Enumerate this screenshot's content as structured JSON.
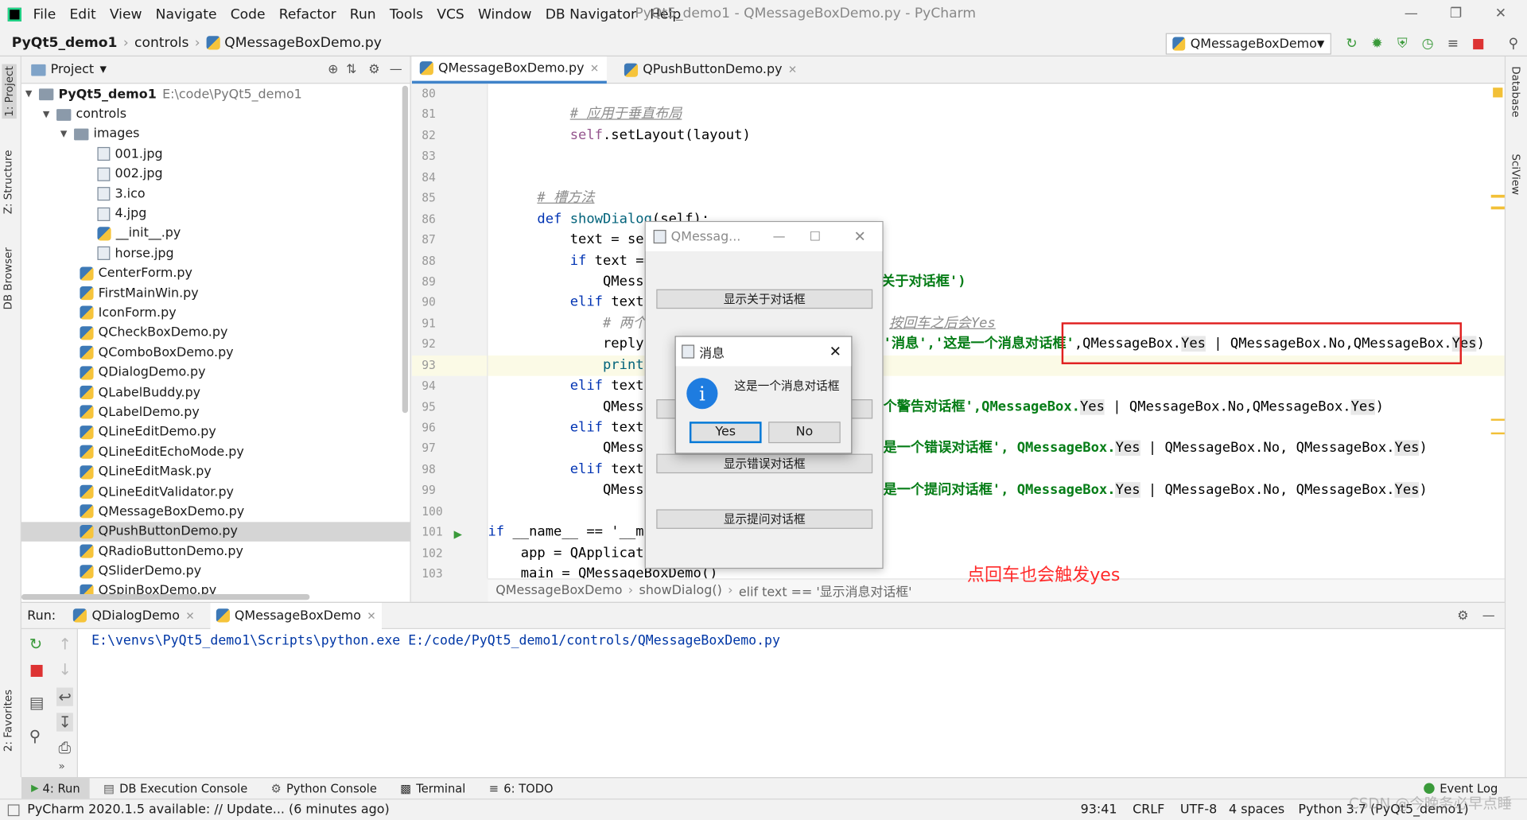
{
  "menu": [
    "File",
    "Edit",
    "View",
    "Navigate",
    "Code",
    "Refactor",
    "Run",
    "Tools",
    "VCS",
    "Window",
    "DB Navigator",
    "Help"
  ],
  "window_title": "PyQt5_demo1 - QMessageBoxDemo.py - PyCharm",
  "nav": {
    "project": "PyQt5_demo1",
    "folder": "controls",
    "file": "QMessageBoxDemo.py",
    "run_config": "QMessageBoxDemo"
  },
  "left_stripe": {
    "project": "1: Project",
    "structure": "Z: Structure",
    "db": "DB Browser",
    "favorites": "2: Favorites"
  },
  "right_stripe": {
    "database": "Database",
    "sciview": "SciView"
  },
  "project_panel": {
    "title": "Project",
    "root": "PyQt5_demo1",
    "root_path": "E:\\code\\PyQt5_demo1",
    "controls": "controls",
    "images": "images",
    "image_files": [
      "001.jpg",
      "002.jpg",
      "3.ico",
      "4.jpg",
      "__init__.py",
      "horse.jpg"
    ],
    "py_files": [
      "CenterForm.py",
      "FirstMainWin.py",
      "IconForm.py",
      "QCheckBoxDemo.py",
      "QComboBoxDemo.py",
      "QDialogDemo.py",
      "QLabelBuddy.py",
      "QLabelDemo.py",
      "QLineEditDemo.py",
      "QLineEditEchoMode.py",
      "QLineEditMask.py",
      "QLineEditValidator.py",
      "QMessageBoxDemo.py",
      "QPushButtonDemo.py",
      "QRadioButtonDemo.py",
      "QSliderDemo.py",
      "QSpinBoxDemo.py"
    ],
    "selected": "QPushButtonDemo.py"
  },
  "editor_tabs": [
    "QMessageBoxDemo.py",
    "QPushButtonDemo.py"
  ],
  "line_numbers": [
    "80",
    "81",
    "82",
    "83",
    "84",
    "85",
    "86",
    "87",
    "88",
    "89",
    "90",
    "91",
    "92",
    "93",
    "94",
    "95",
    "96",
    "97",
    "98",
    "99",
    "100",
    "101",
    "102",
    "103"
  ],
  "code": {
    "l81": "# 应用于垂直布局",
    "l82a": "self",
    "l82b": ".setLayout(layout)",
    "l85": "# 槽方法",
    "l86a": "def",
    "l86b": "showDialog",
    "l86c": "(self):",
    "l87": "text = self",
    "l88a": "if",
    "l88b": "text ==",
    "l89a": "QMessag",
    "l89b": "关于对话框')",
    "l90a": "elif",
    "l90b": "text =",
    "l91a": "# 两个选",
    "l91b": "按回车之后会Yes",
    "l92a": "reply =",
    "l92b": "'消息','这是一个消息对话框'",
    ",l92c": "",
    "l92c": ",QMessageBox.",
    "l92d": "Yes",
    " l92e": "",
    "l92e": " | QMessageBox.No,QMessageBox.",
    "l92f": "Yes",
    ")": "",
    "l92g": ")",
    "l93a": "print(r",
    "l94a": "elif",
    "l94b": "text =",
    "l95a": "QMessag",
    "l95b": "个警告对话框',QMessageBox.",
    "l95c": "Yes",
    "l95d": " | QMessageBox.No,QMessageBox.",
    "l95e": "Yes",
    "l95f": ")",
    "l96a": "elif",
    "l96b": "text =",
    "l97a": "QMessag",
    "l97b": "是一个错误对话框', QMessageBox.",
    "l97c": "Yes",
    "l97d": " | QMessageBox.No, QMessageBox.",
    "l97e": "Yes",
    "l97f": ")",
    "l98a": "elif",
    "l98b": "text =",
    "l99a": "QMessag",
    "l99b": "是一个提问对话框', QMessageBox.",
    "l99c": "Yes",
    "l99d": " | QMessageBox.No, QMessageBox.",
    "l99e": "Yes",
    "l99f": ")",
    "l101a": "if",
    "l101b": " __name__ == '__m",
    "l102": "app = QApplicat",
    "l103": "main = QMessageBoxDemo()"
  },
  "editor_breadcrumb": [
    "QMessageBoxDemo",
    "showDialog()",
    "elif text == '显示消息对话框'"
  ],
  "annotation": "点回车也会触发yes",
  "qt_window": {
    "title": "QMessag...",
    "buttons": [
      "显示关于对话框",
      "显示错误对话框",
      "显示提问对话框"
    ]
  },
  "message_box": {
    "title": "消息",
    "text": "这是一个消息对话框",
    "yes": "Yes",
    "no": "No"
  },
  "run_panel": {
    "label": "Run:",
    "tabs": [
      "QDialogDemo",
      "QMessageBoxDemo"
    ],
    "console": "E:\\venvs\\PyQt5_demo1\\Scripts\\python.exe E:/code/PyQt5_demo1/controls/QMessageBoxDemo.py"
  },
  "bottom_tabs": [
    "4: Run",
    "DB Execution Console",
    "Python Console",
    "Terminal",
    "6: TODO"
  ],
  "event_log": "Event Log",
  "status": {
    "message": "PyCharm 2020.1.5 available: // Update... (6 minutes ago)",
    "position": "93:41",
    "line_sep": "CRLF",
    "encoding": "UTF-8",
    "indent": "4 spaces",
    "interpreter": "Python 3.7 (PyQt5_demo1)"
  },
  "watermark": "CSDN @今晚务必早点睡"
}
